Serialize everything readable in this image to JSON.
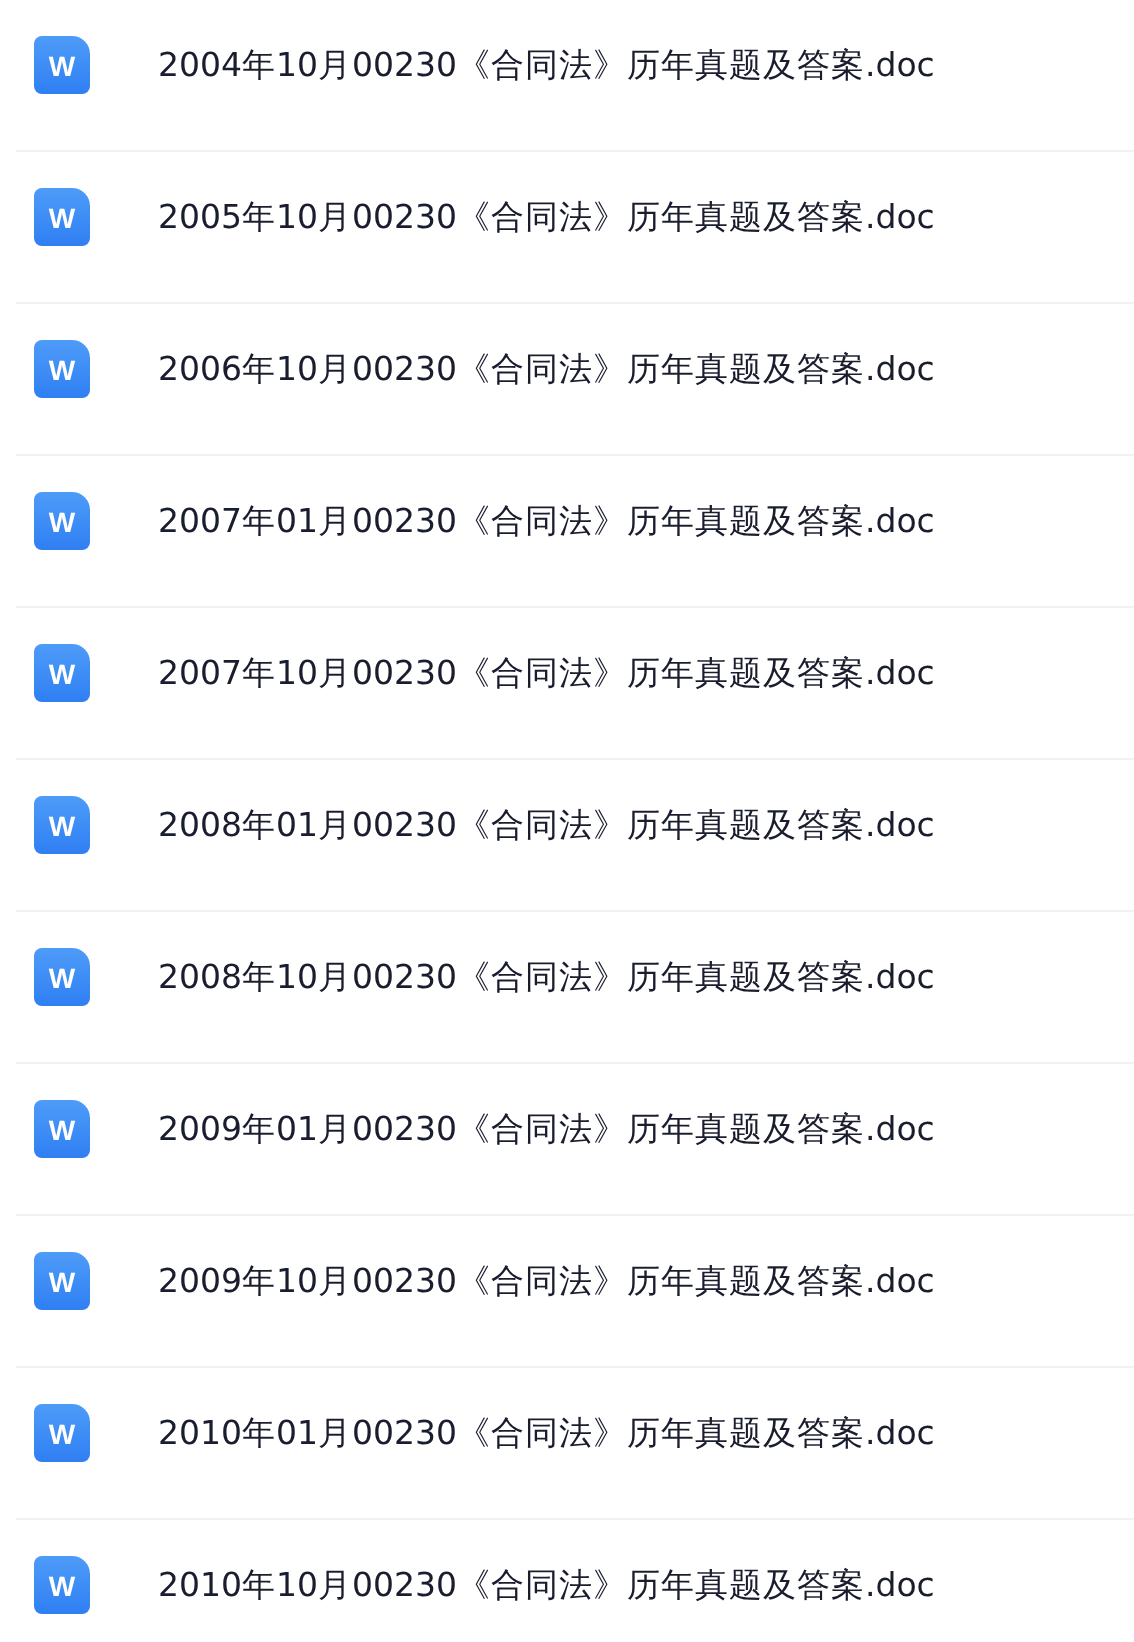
{
  "files": [
    {
      "icon_label": "W",
      "name": "2004年10月00230《合同法》历年真题及答案.doc"
    },
    {
      "icon_label": "W",
      "name": "2005年10月00230《合同法》历年真题及答案.doc"
    },
    {
      "icon_label": "W",
      "name": "2006年10月00230《合同法》历年真题及答案.doc"
    },
    {
      "icon_label": "W",
      "name": "2007年01月00230《合同法》历年真题及答案.doc"
    },
    {
      "icon_label": "W",
      "name": "2007年10月00230《合同法》历年真题及答案.doc"
    },
    {
      "icon_label": "W",
      "name": "2008年01月00230《合同法》历年真题及答案.doc"
    },
    {
      "icon_label": "W",
      "name": "2008年10月00230《合同法》历年真题及答案.doc"
    },
    {
      "icon_label": "W",
      "name": "2009年01月00230《合同法》历年真题及答案.doc"
    },
    {
      "icon_label": "W",
      "name": "2009年10月00230《合同法》历年真题及答案.doc"
    },
    {
      "icon_label": "W",
      "name": "2010年01月00230《合同法》历年真题及答案.doc"
    },
    {
      "icon_label": "W",
      "name": "2010年10月00230《合同法》历年真题及答案.doc"
    }
  ]
}
